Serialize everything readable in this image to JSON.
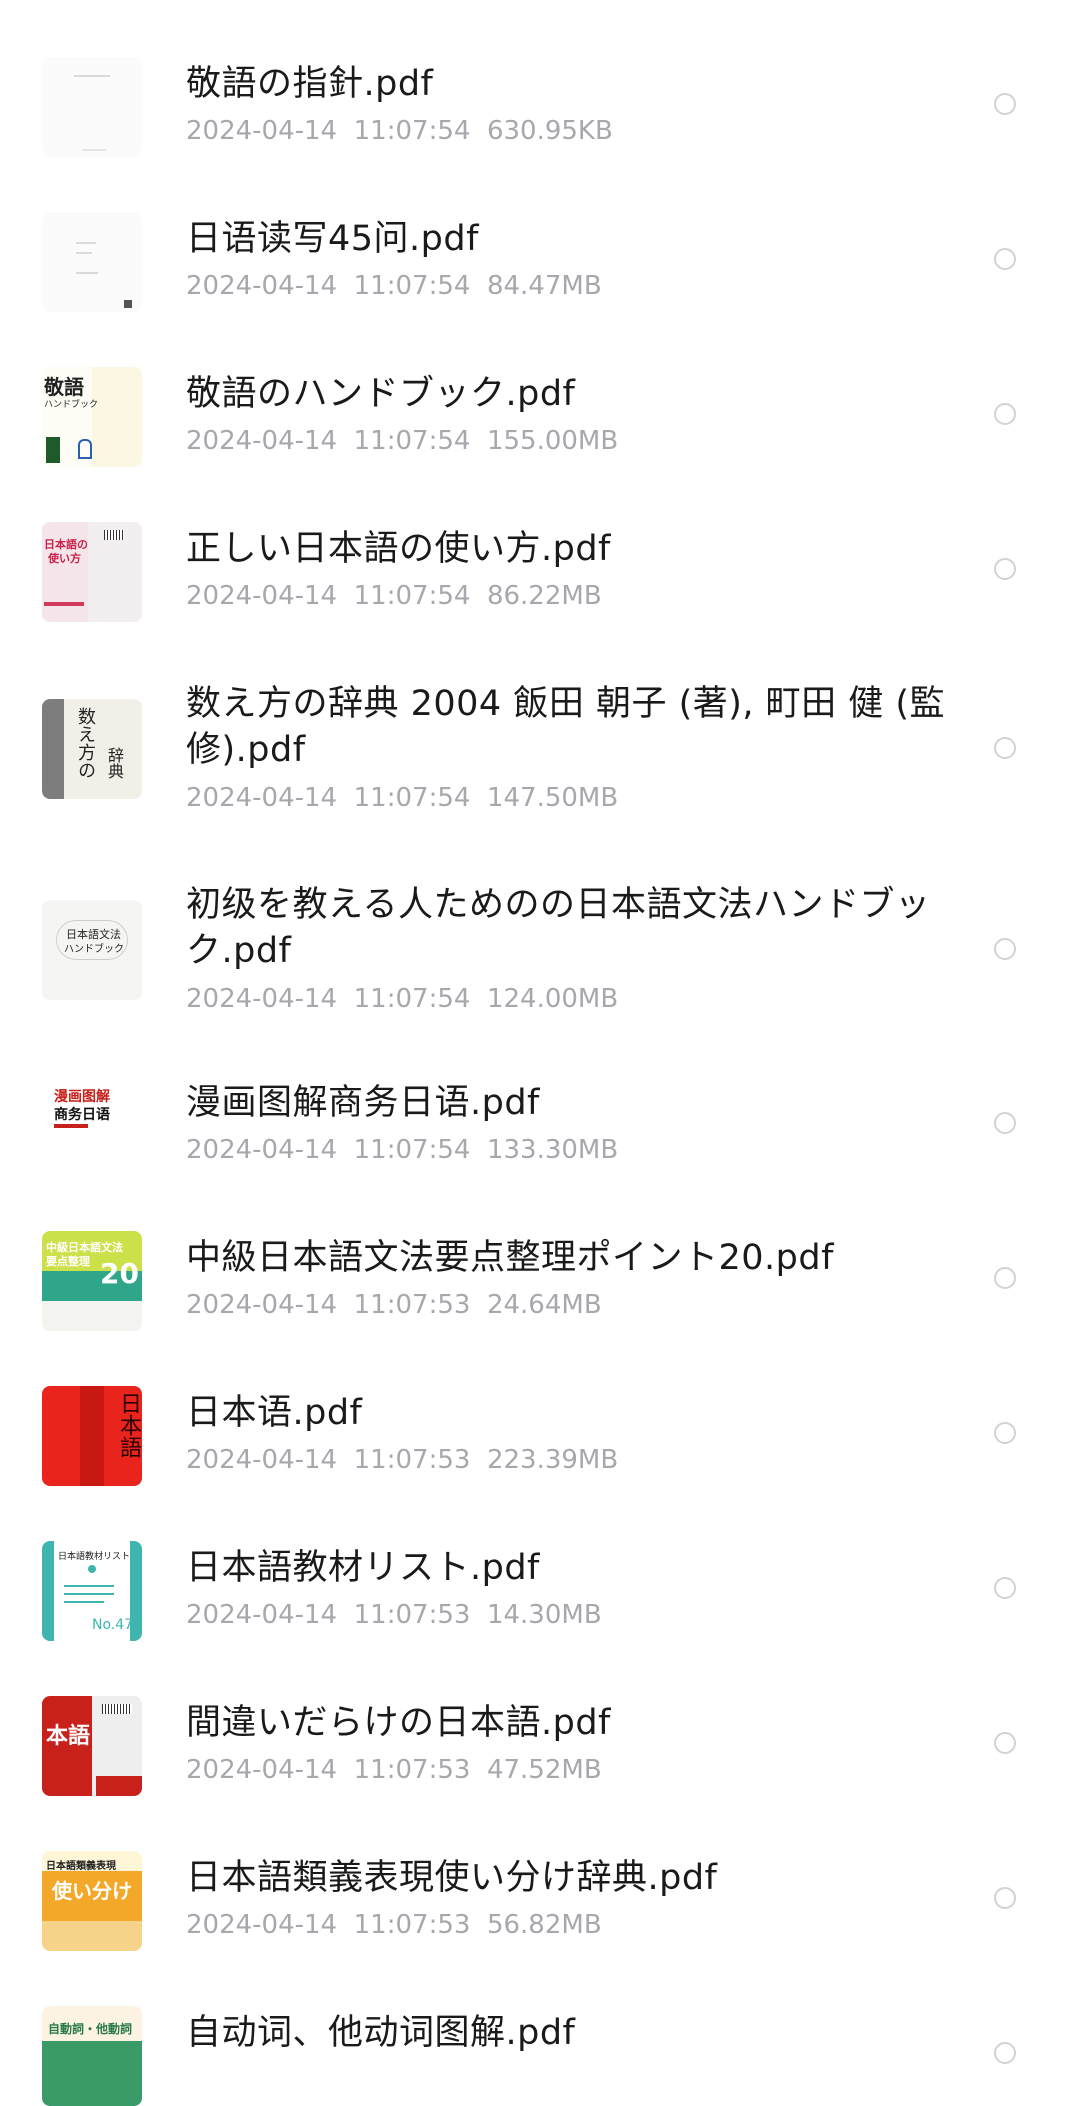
{
  "files": [
    {
      "name": "敬語の指針.pdf",
      "date": "2024-04-14",
      "time": "11:07:54",
      "size": "630.95KB",
      "thumb_icon": "pdf-thumbnail-icon"
    },
    {
      "name": "日语读写45问.pdf",
      "date": "2024-04-14",
      "time": "11:07:54",
      "size": "84.47MB",
      "thumb_icon": "pdf-thumbnail-icon"
    },
    {
      "name": "敬語のハンドブック.pdf",
      "date": "2024-04-14",
      "time": "11:07:54",
      "size": "155.00MB",
      "thumb_icon": "pdf-thumbnail-icon"
    },
    {
      "name": "正しい日本語の使い方.pdf",
      "date": "2024-04-14",
      "time": "11:07:54",
      "size": "86.22MB",
      "thumb_icon": "pdf-thumbnail-icon"
    },
    {
      "name": "数え方の辞典 2004 飯田 朝子 (著), 町田 健 (監修).pdf",
      "date": "2024-04-14",
      "time": "11:07:54",
      "size": "147.50MB",
      "thumb_icon": "pdf-thumbnail-icon"
    },
    {
      "name": "初级を教える人ためのの日本語文法ハンドブック.pdf",
      "date": "2024-04-14",
      "time": "11:07:54",
      "size": "124.00MB",
      "thumb_icon": "pdf-thumbnail-icon"
    },
    {
      "name": "漫画图解商务日语.pdf",
      "date": "2024-04-14",
      "time": "11:07:54",
      "size": "133.30MB",
      "thumb_icon": "pdf-thumbnail-icon"
    },
    {
      "name": "中級日本語文法要点整理ポイント20.pdf",
      "date": "2024-04-14",
      "time": "11:07:53",
      "size": "24.64MB",
      "thumb_icon": "pdf-thumbnail-icon"
    },
    {
      "name": "日本语.pdf",
      "date": "2024-04-14",
      "time": "11:07:53",
      "size": "223.39MB",
      "thumb_icon": "pdf-thumbnail-icon"
    },
    {
      "name": "日本語教材リスト.pdf",
      "date": "2024-04-14",
      "time": "11:07:53",
      "size": "14.30MB",
      "thumb_icon": "pdf-thumbnail-icon"
    },
    {
      "name": "間違いだらけの日本語.pdf",
      "date": "2024-04-14",
      "time": "11:07:53",
      "size": "47.52MB",
      "thumb_icon": "pdf-thumbnail-icon"
    },
    {
      "name": "日本語類義表現使い分け辞典.pdf",
      "date": "2024-04-14",
      "time": "11:07:53",
      "size": "56.82MB",
      "thumb_icon": "pdf-thumbnail-icon"
    },
    {
      "name": "自动词、他动词图解.pdf",
      "date": "",
      "time": "",
      "size": "",
      "thumb_icon": "pdf-thumbnail-icon"
    }
  ],
  "thumbnails": {
    "t3_title": "敬語",
    "t3_sub": "ハンドブック",
    "t4_title": "日本語の",
    "t4_sub": "使い方",
    "t5_title": "数え方の",
    "t5_sub": "辞典",
    "t6_title": "日本語文法",
    "t6_sub": "ハンドブック",
    "t7_title": "漫画图解",
    "t7_sub": "商务日语",
    "t8_title": "中級日本語文法",
    "t8_sub": "要点整理",
    "t8_num": "20",
    "t9_title": "日本語",
    "t10_title": "日本語教材リスト",
    "t10_num": "No.47",
    "t11_title": "本語",
    "t12_title": "日本語類義表現",
    "t12_sub": "使い分け",
    "t13_title": "自動詞・他動詞"
  },
  "colors": {
    "name_text": "#1a1a1a",
    "meta_text": "#a6a8ad",
    "radio_border": "#d0d2d6",
    "background": "#ffffff"
  }
}
